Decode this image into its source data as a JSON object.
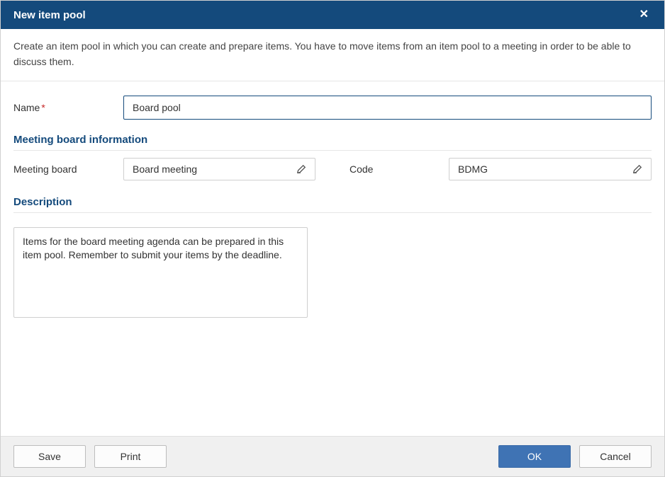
{
  "dialog": {
    "title": "New item pool",
    "intro": "Create an item pool in which you can create and prepare items. You have to move items from an item pool to a meeting in order to be able to discuss them."
  },
  "fields": {
    "name_label": "Name",
    "name_value": "Board pool"
  },
  "meeting_board_section": {
    "title": "Meeting board information",
    "board_label": "Meeting board",
    "board_value": "Board meeting",
    "code_label": "Code",
    "code_value": "BDMG"
  },
  "description_section": {
    "title": "Description",
    "value": "Items for the board meeting agenda can be prepared in this item pool. Remember to submit your items by the deadline."
  },
  "footer": {
    "save": "Save",
    "print": "Print",
    "ok": "OK",
    "cancel": "Cancel"
  }
}
